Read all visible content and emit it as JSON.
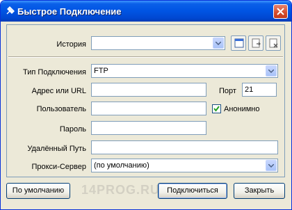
{
  "window": {
    "title": "Быстрое Подключение"
  },
  "form": {
    "history": {
      "label": "История",
      "value": ""
    },
    "connection_type": {
      "label": "Тип Подключения",
      "value": "FTP"
    },
    "address": {
      "label": "Адрес или URL",
      "value": ""
    },
    "port": {
      "label": "Порт",
      "value": "21"
    },
    "user": {
      "label": "Пользователь",
      "value": ""
    },
    "anonymous": {
      "label": "Анонимно",
      "checked": true
    },
    "password": {
      "label": "Пароль",
      "value": ""
    },
    "remote_path": {
      "label": "Удалённый Путь",
      "value": ""
    },
    "proxy": {
      "label": "Прокси-Сервер",
      "value": "(по умолчанию)"
    }
  },
  "buttons": {
    "default_label": "По умолчанию",
    "connect_label": "Подключиться",
    "close_label": "Закрыть"
  },
  "watermark": "14PROG.RU",
  "icons": {
    "title": "plug-icon",
    "history_tools": [
      "window-icon",
      "save-icon",
      "delete-icon"
    ]
  }
}
